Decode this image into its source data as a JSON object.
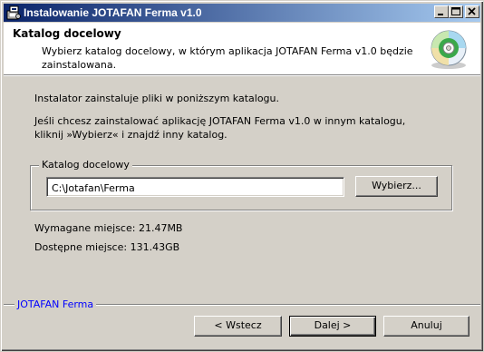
{
  "window": {
    "title": "Instalowanie JOTAFAN Ferma v1.0",
    "icon": "installer-icon",
    "controls": [
      "minimize-icon",
      "maximize-icon",
      "close-icon"
    ]
  },
  "header": {
    "title": "Katalog docelowy",
    "description": "Wybierz katalog docelowy, w którym aplikacja JOTAFAN Ferma v1.0 będzie zainstalowana.",
    "icon": "cd-disc-icon"
  },
  "body": {
    "intro": "Instalator zainstaluje pliki w poniższym katalogu.",
    "instruction_line1": "Jeśli chcesz zainstalować aplikację JOTAFAN Ferma v1.0 w innym katalogu,",
    "instruction_line2": "kliknij »Wybierz« i znajdź inny katalog.",
    "destination_group_label": "Katalog docelowy",
    "destination_path": "C:\\Jotafan\\Ferma",
    "browse_label": "Wybierz...",
    "space_required": "Wymagane miejsce: 21.47MB",
    "space_available": "Dostępne miejsce: 131.43GB"
  },
  "footer": {
    "brand": "JOTAFAN Ferma",
    "back_label": "< Wstecz",
    "next_label": "Dalej >",
    "cancel_label": "Anuluj"
  },
  "colors": {
    "titlebar_start": "#0a246a",
    "titlebar_end": "#a6caf0",
    "dialog_face": "#d4d0c8",
    "brand_text": "#0000ff"
  }
}
